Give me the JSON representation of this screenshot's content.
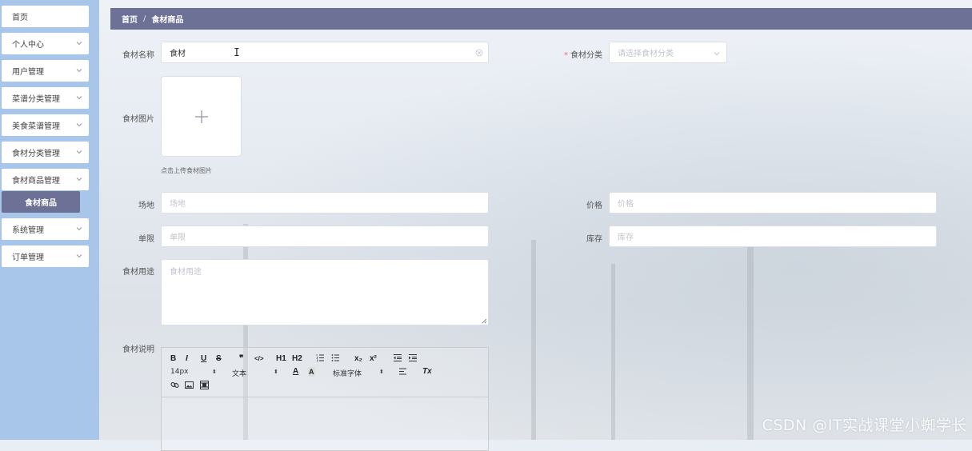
{
  "sidebar": {
    "items": [
      {
        "label": "首页",
        "has_arrow": false
      },
      {
        "label": "个人中心",
        "has_arrow": true
      },
      {
        "label": "用户管理",
        "has_arrow": true
      },
      {
        "label": "菜谱分类管理",
        "has_arrow": true
      },
      {
        "label": "美食菜谱管理",
        "has_arrow": true
      },
      {
        "label": "食材分类管理",
        "has_arrow": true
      },
      {
        "label": "食材商品管理",
        "has_arrow": true
      },
      {
        "label": "系统管理",
        "has_arrow": true
      },
      {
        "label": "订单管理",
        "has_arrow": true
      }
    ],
    "active_sub_item": "食材商品"
  },
  "breadcrumb": {
    "home": "首页",
    "separator": "/",
    "current": "食材商品"
  },
  "form": {
    "name": {
      "label": "食材名称",
      "value": "食材"
    },
    "category": {
      "label": "食材分类",
      "required_mark": "*",
      "placeholder": "请选择食材分类"
    },
    "image": {
      "label": "食材图片",
      "hint": "点击上传食材图片"
    },
    "venue": {
      "label": "场地",
      "placeholder": "场地"
    },
    "price": {
      "label": "价格",
      "placeholder": "价格"
    },
    "limit": {
      "label": "单限",
      "placeholder": "单限"
    },
    "stock": {
      "label": "库存",
      "placeholder": "库存"
    },
    "usage": {
      "label": "食材用途",
      "placeholder": "食材用途"
    },
    "description": {
      "label": "食材说明"
    }
  },
  "editor": {
    "buttons": [
      "B",
      "I",
      "U",
      "S",
      "❞",
      "</>",
      "H1",
      "H2",
      "x₂",
      "x²",
      "Tx"
    ],
    "font_size": "14px",
    "text_style": "文本",
    "font_family": "标准字体"
  },
  "watermark": "CSDN @IT实战课堂小蜘学长",
  "colors": {
    "sidebar_bg": "#a8c6ea",
    "accent": "#6d7196",
    "required": "#f56c6c"
  }
}
